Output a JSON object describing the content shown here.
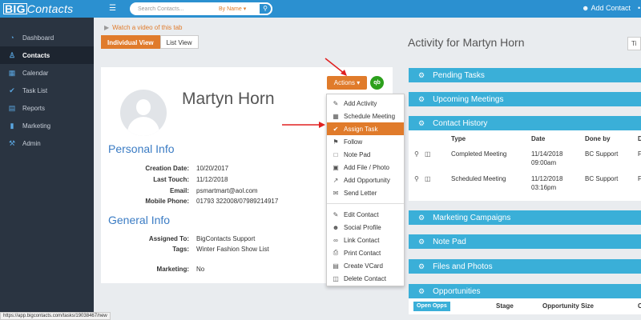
{
  "header": {
    "logo_bold": "BIG",
    "logo_rest": "Contacts",
    "search_placeholder": "Search Contacts...",
    "search_mode": "By Name ▾",
    "add_contact": "Add Contact"
  },
  "sidebar": {
    "items": [
      {
        "label": "Dashboard",
        "icon": "dashboard-icon"
      },
      {
        "label": "Contacts",
        "icon": "user-icon"
      },
      {
        "label": "Calendar",
        "icon": "calendar-icon"
      },
      {
        "label": "Task List",
        "icon": "check-circle-icon"
      },
      {
        "label": "Reports",
        "icon": "document-icon"
      },
      {
        "label": "Marketing",
        "icon": "bar-chart-icon"
      },
      {
        "label": "Admin",
        "icon": "wrench-icon"
      }
    ]
  },
  "main": {
    "watch_video": "Watch a video of this tab",
    "view_tabs": [
      "Individual View",
      "List View"
    ],
    "contact_name": "Martyn Horn",
    "personal_info_title": "Personal Info",
    "personal_fields": [
      {
        "label": "Creation Date:",
        "value": "10/20/2017"
      },
      {
        "label": "Last Touch:",
        "value": "11/12/2018"
      },
      {
        "label": "Email:",
        "value": "psmartmart@aol.com"
      },
      {
        "label": "Mobile Phone:",
        "value": "01793 322008/07989214917"
      }
    ],
    "general_info_title": "General Info",
    "general_fields": [
      {
        "label": "Assigned To:",
        "value": "BigContacts Support"
      },
      {
        "label": "Tags:",
        "value": "Winter Fashion Show List"
      },
      {
        "label": "Marketing:",
        "value": "No"
      }
    ],
    "actions_label": "Actions ▾",
    "qb_label": "qb"
  },
  "actions_menu": {
    "group1": [
      {
        "label": "Add Activity",
        "icon": "edit-icon"
      },
      {
        "label": "Schedule Meeting",
        "icon": "calendar-icon"
      },
      {
        "label": "Assign Task",
        "icon": "check-circle-icon"
      },
      {
        "label": "Follow",
        "icon": "flag-icon"
      },
      {
        "label": "Note Pad",
        "icon": "note-icon"
      },
      {
        "label": "Add File / Photo",
        "icon": "image-icon"
      },
      {
        "label": "Add Opportunity",
        "icon": "trend-icon"
      },
      {
        "label": "Send Letter",
        "icon": "letter-icon"
      }
    ],
    "group2": [
      {
        "label": "Edit Contact",
        "icon": "pencil-icon"
      },
      {
        "label": "Social Profile",
        "icon": "profile-icon"
      },
      {
        "label": "Link Contact",
        "icon": "link-icon"
      },
      {
        "label": "Print Contact",
        "icon": "print-icon"
      },
      {
        "label": "Create VCard",
        "icon": "vcard-icon"
      },
      {
        "label": "Delete Contact",
        "icon": "trash-icon"
      }
    ],
    "highlighted": "Assign Task"
  },
  "activity": {
    "title": "Activity for Martyn Horn",
    "filter_stub": "Ti",
    "panels": [
      "Pending Tasks",
      "Upcoming Meetings",
      "Contact History",
      "Marketing Campaigns",
      "Note Pad",
      "Files and Photos",
      "Opportunities"
    ],
    "history": {
      "columns": [
        "Type",
        "Date",
        "Done by",
        "D"
      ],
      "rows": [
        {
          "type": "Completed Meeting",
          "date_line1": "11/14/2018",
          "date_line2": "09:00am",
          "done_by": "BC Support",
          "d": "F"
        },
        {
          "type": "Scheduled Meeting",
          "date_line1": "11/12/2018",
          "date_line2": "03:16pm",
          "done_by": "BC Support",
          "d": "F"
        }
      ]
    },
    "opportunities": {
      "tab": "Open Opps",
      "columns": [
        "Stage",
        "Opportunity Size",
        "C"
      ]
    }
  },
  "status_url": "https://app.bigcontacts.com/tasks/19038467/new",
  "colors": {
    "topbar": "#2b90d0",
    "sidebar": "#2a3441",
    "accent_orange": "#e07b2b",
    "panel_blue": "#3aafd8",
    "arrow_red": "#e02020"
  }
}
